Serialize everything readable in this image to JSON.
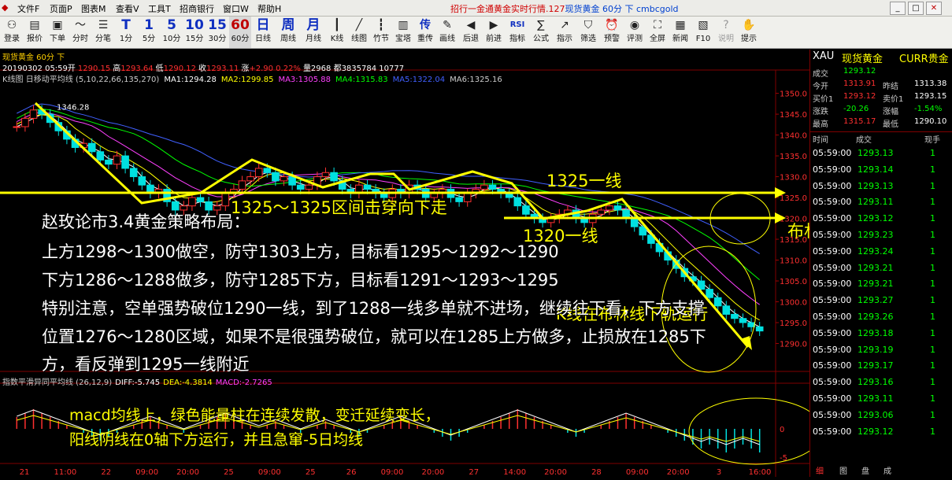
{
  "menubar": {
    "items": [
      "文件F",
      "页面P",
      "图表M",
      "查看V",
      "工具T",
      "招商银行",
      "窗口W",
      "帮助H"
    ],
    "ticker_red": "招行一金通黄金实时行情.127",
    "ticker_blue": "现货黄金 60分 下 cmbcgold"
  },
  "toolbar": {
    "buttons": [
      {
        "icon": "登",
        "label": "登录"
      },
      {
        "icon": "报",
        "label": "报价"
      },
      {
        "icon": "▼",
        "label": "下单"
      },
      {
        "icon": "分",
        "label": "分时"
      },
      {
        "icon": "笔",
        "label": "分笔"
      },
      {
        "icon": "T",
        "label": "1"
      },
      {
        "icon": "1",
        "label": "5"
      },
      {
        "icon": "5",
        "label": "10"
      },
      {
        "icon": "10",
        "label": "15"
      },
      {
        "icon": "15",
        "label": "30"
      },
      {
        "icon": "30",
        "label": "60"
      },
      {
        "icon": "60",
        "label": "日线"
      },
      {
        "icon": "日",
        "label": "周线"
      },
      {
        "icon": "周",
        "label": "月线"
      },
      {
        "icon": "月",
        "label": "K线"
      }
    ],
    "row_icons": [
      "T",
      "1",
      "5",
      "10",
      "15",
      "30",
      "60",
      "日",
      "周",
      "月"
    ],
    "row_labels": [
      "登录",
      "报价",
      "下单",
      "分时",
      "分笔",
      "1分",
      "5分",
      "10分",
      "15分",
      "30分",
      "60分",
      "日线",
      "周线",
      "月线",
      "K线",
      "线图",
      "竹节",
      "宝塔",
      "重传",
      "画线",
      "后退",
      "前进",
      "指标",
      "公式",
      "指示",
      "筛选",
      "预警",
      "评测",
      "全屏",
      "新闻",
      "F10",
      "说明",
      "提示"
    ]
  },
  "chart_header": {
    "symbol_title": "现货黄金 60分 下",
    "date": "20190302 05:59开",
    "open": "1290.15",
    "high_label": "高",
    "high": "1293.64",
    "low_label": "低",
    "low": "1290.12",
    "close_label": "收",
    "close": "1293.11",
    "change_label": "涨",
    "change": "+2.90 0.22%",
    "volume": "量2968 都3835784 10777",
    "ma_title": "K线图 日移动平均线 (5,10,22,66,135,270)",
    "ma1": "MA1:1294.28",
    "ma2": "MA2:1299.85",
    "ma3": "MA3:1305.88",
    "ma4": "MA4:1315.83",
    "ma5": "MA5:1322.04",
    "ma6": "MA6:1325.16"
  },
  "macd_header": {
    "title": "指数平滑异同平均线 (26,12,9)",
    "diff": "DIFF:-5.745",
    "dea": "DEA:-4.3814",
    "macd": "MACD:-2.7265"
  },
  "chart_data": {
    "type": "candlestick",
    "ylim": [
      1285,
      1352
    ],
    "y_ticks": [
      1350,
      1345,
      1340,
      1335,
      1330,
      1325,
      1320,
      1315,
      1310,
      1305,
      1300,
      1295,
      1290
    ],
    "y_tick_labels": [
      "1350.0",
      "1345.0",
      "1340.0",
      "1335.0",
      "1330.0",
      "1325.0",
      "1320.0",
      "1315.0",
      "1310.0",
      "1305.0",
      "1300.0",
      "1295.0",
      "1290.0"
    ],
    "x_labels": [
      "21",
      "11:00",
      "22",
      "09:00",
      "20:00",
      "25",
      "09:00",
      "25",
      "26",
      "09:00",
      "20:00",
      "27",
      "14:00",
      "20:00",
      "28",
      "09:00",
      "20:00",
      "3",
      "16:00"
    ],
    "peak_label": "1346.28",
    "macd_ticks": [
      "0",
      "-5"
    ],
    "candles": [
      1342,
      1344,
      1346,
      1345,
      1343,
      1341,
      1339,
      1337,
      1338,
      1336,
      1334,
      1333,
      1335,
      1332,
      1330,
      1328,
      1326,
      1327,
      1324,
      1322,
      1323,
      1325,
      1324,
      1322,
      1323,
      1326,
      1327,
      1329,
      1330,
      1332,
      1331,
      1329,
      1330,
      1328,
      1327,
      1328,
      1330,
      1331,
      1329,
      1327,
      1326,
      1328,
      1327,
      1326,
      1325,
      1327,
      1326,
      1328,
      1327,
      1325,
      1326,
      1327,
      1325,
      1324,
      1326,
      1327,
      1328,
      1327,
      1326,
      1325,
      1323,
      1321,
      1320,
      1319,
      1320,
      1321,
      1322,
      1320,
      1319,
      1321,
      1322,
      1323,
      1322,
      1320,
      1318,
      1316,
      1314,
      1312,
      1310,
      1308,
      1306,
      1305,
      1303,
      1301,
      1299,
      1297,
      1296,
      1295,
      1294,
      1293
    ],
    "macd_hist": [
      3,
      4,
      5,
      4,
      3,
      2,
      1,
      0,
      -1,
      -2,
      -3,
      -2,
      -1,
      0,
      1,
      2,
      3,
      2,
      1,
      0,
      -1,
      0,
      1,
      2,
      3,
      4,
      3,
      2,
      1,
      0,
      1,
      2,
      1,
      0,
      -1,
      0,
      1,
      2,
      1,
      0,
      -1,
      -2,
      -1,
      0,
      1,
      2,
      3,
      2,
      1,
      0,
      -1,
      -2,
      -3,
      -2,
      -1,
      0,
      1,
      2,
      3,
      4,
      5,
      4,
      3,
      2,
      1,
      0,
      -1,
      -2,
      -1,
      0,
      1,
      2,
      3,
      4,
      3,
      2,
      1,
      0,
      -1,
      -2,
      -3,
      -4,
      -5,
      -4,
      -5,
      -6,
      -5,
      -4,
      -5,
      -6
    ]
  },
  "annotations": {
    "range_label": "1325～1325区间击穿向下走",
    "line_1325": "1325一线",
    "line_1320": "1320一线",
    "bollinger": "布林线向下运行",
    "k_bollinger": "K线在布林线下轨运行",
    "macd_note_1": "macd均线上，绿色能量柱在连续发散，变迁延续变长，",
    "macd_note_2": "阳线阴线在0轴下方运行，并且急窜-5日均线"
  },
  "overlay": {
    "line1": "赵玫论市3.4黄金策略布局：",
    "line2": "上方1298～1300做空，防守1303上方，目标看1295～1292～1290",
    "line3": "下方1286～1288做多，防守1285下方，目标看1291～1293～1295",
    "line4": "特别注意，空单强势破位1290一线，到了1288一线多单就不进场，继续往下看，下方支撑",
    "line5": "位置1276～1280区域，如果不是很强势破位，就可以在1285上方做多，止损放在1285下",
    "line6": "方，看反弹到1295一线附近"
  },
  "quote_panel": {
    "code": "XAU",
    "name": "现货黄金",
    "market": "CURR贵金",
    "rows": [
      {
        "l1": "成交",
        "v1": "1293.12",
        "l2": "",
        "v2": ""
      },
      {
        "l1": "今开",
        "v1": "1313.91",
        "l2": "昨结",
        "v2": "1313.38"
      },
      {
        "l1": "买价1",
        "v1": "1293.12",
        "l2": "卖价1",
        "v2": "1293.15"
      },
      {
        "l1": "涨跌",
        "v1": "-20.26",
        "l2": "涨幅",
        "v2": "-1.54%"
      },
      {
        "l1": "最高",
        "v1": "1315.17",
        "l2": "最低",
        "v2": "1290.10"
      }
    ],
    "tick_header": {
      "time": "时间",
      "price": "成交",
      "vol": "现手"
    },
    "ticks": [
      {
        "time": "05:59:00",
        "price": "1293.13",
        "vol": "1"
      },
      {
        "time": "05:59:00",
        "price": "1293.14",
        "vol": "1"
      },
      {
        "time": "05:59:00",
        "price": "1293.13",
        "vol": "1"
      },
      {
        "time": "05:59:00",
        "price": "1293.11",
        "vol": "1"
      },
      {
        "time": "05:59:00",
        "price": "1293.12",
        "vol": "1"
      },
      {
        "time": "05:59:00",
        "price": "1293.23",
        "vol": "1"
      },
      {
        "time": "05:59:00",
        "price": "1293.24",
        "vol": "1"
      },
      {
        "time": "05:59:00",
        "price": "1293.21",
        "vol": "1"
      },
      {
        "time": "05:59:00",
        "price": "1293.21",
        "vol": "1"
      },
      {
        "time": "05:59:00",
        "price": "1293.27",
        "vol": "1"
      },
      {
        "time": "05:59:00",
        "price": "1293.26",
        "vol": "1"
      },
      {
        "time": "05:59:00",
        "price": "1293.18",
        "vol": "1"
      },
      {
        "time": "05:59:00",
        "price": "1293.19",
        "vol": "1"
      },
      {
        "time": "05:59:00",
        "price": "1293.17",
        "vol": "1"
      },
      {
        "time": "05:59:00",
        "price": "1293.16",
        "vol": "1"
      },
      {
        "time": "05:59:00",
        "price": "1293.11",
        "vol": "1"
      },
      {
        "time": "05:59:00",
        "price": "1293.06",
        "vol": "1"
      },
      {
        "time": "05:59:00",
        "price": "1293.12",
        "vol": "1"
      }
    ],
    "tabs": [
      "细",
      "图",
      "盘",
      "成"
    ]
  },
  "colors": {
    "up": "#ff3030",
    "down": "#00e0e0",
    "ma1": "#ffffff",
    "ma2": "#ffff00",
    "ma3": "#ff40ff",
    "ma4": "#00ff00",
    "ma5": "#4060ff",
    "ann": "#ffff00"
  }
}
